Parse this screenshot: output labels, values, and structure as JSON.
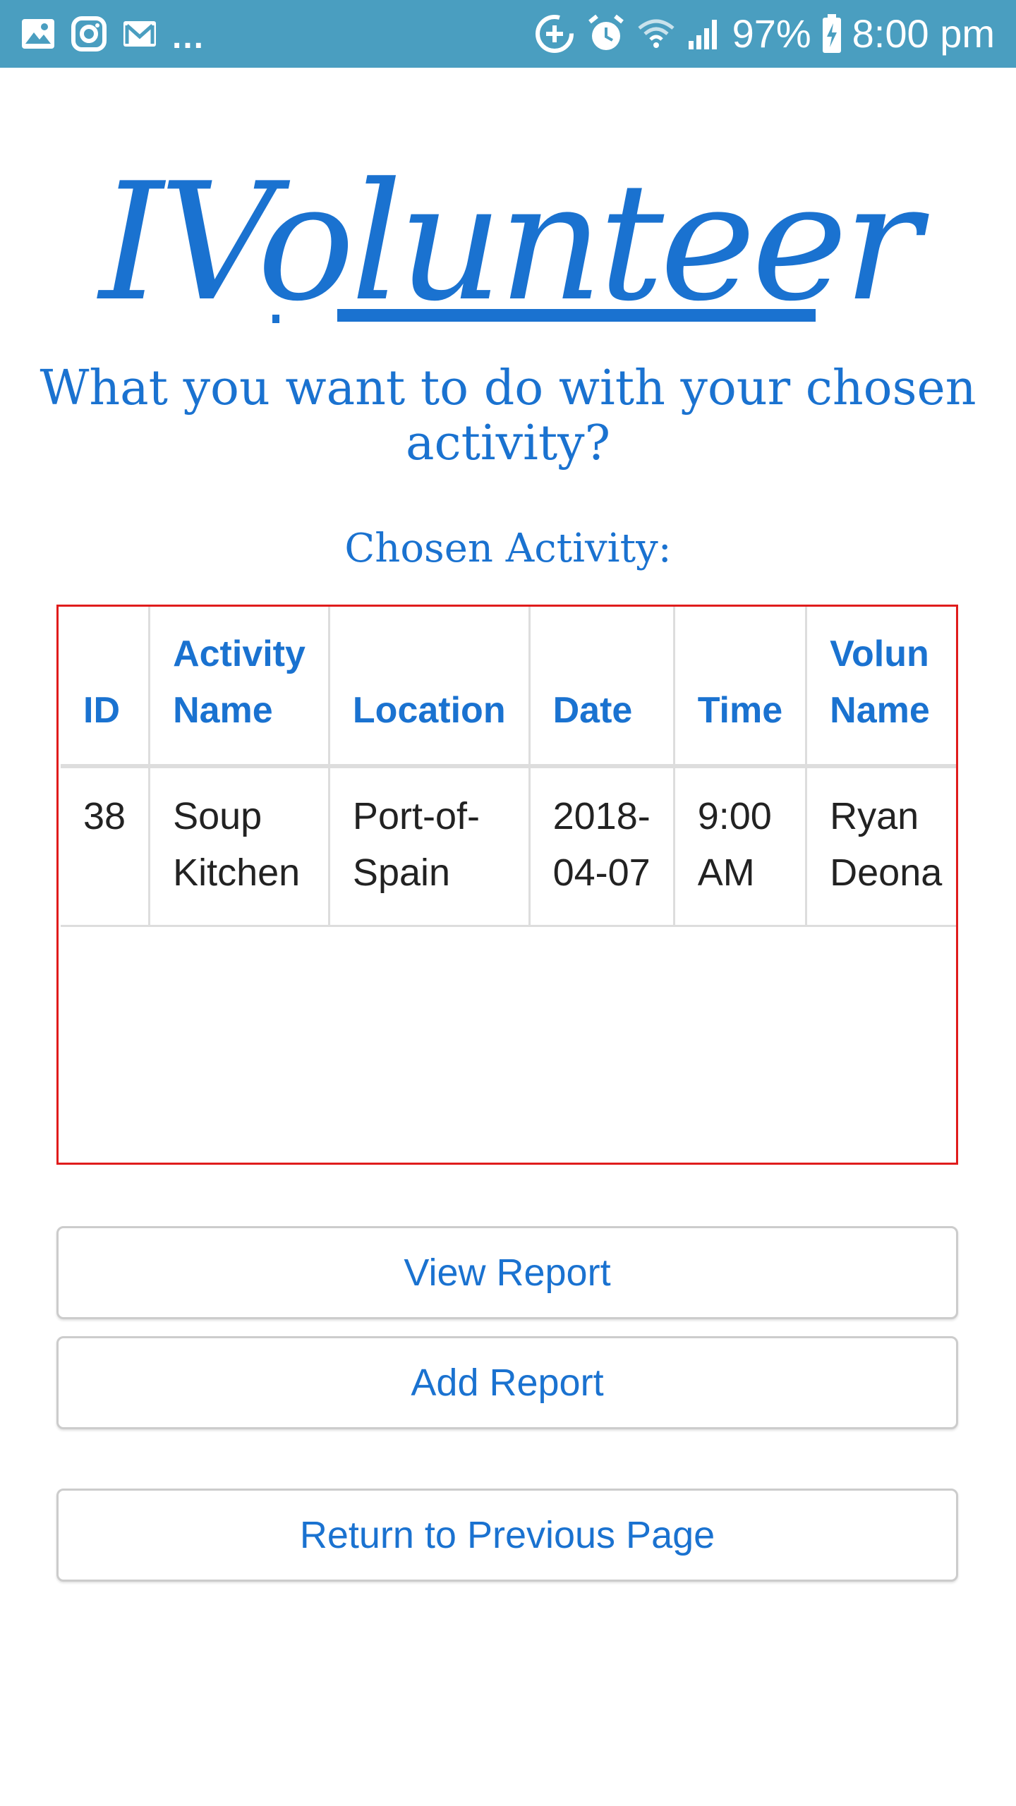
{
  "status_bar": {
    "left_icons": [
      "gallery-icon",
      "instagram-icon",
      "gmail-icon"
    ],
    "more": "...",
    "right_icons": [
      "data-saver-icon",
      "alarm-icon",
      "wifi-icon",
      "signal-icon",
      "battery-charging-icon"
    ],
    "battery": "97%",
    "time": "8:00 pm"
  },
  "app": {
    "logo": "IVolunteer",
    "heading": "What you want to do with your chosen activity?",
    "subheading": "Chosen Activity:"
  },
  "table": {
    "headers": [
      [
        "ID"
      ],
      [
        "Activity",
        "Name"
      ],
      [
        "Location"
      ],
      [
        "Date"
      ],
      [
        "Time"
      ],
      [
        "Volun",
        "Name"
      ]
    ],
    "rows": [
      [
        [
          "38"
        ],
        [
          "Soup",
          "Kitchen"
        ],
        [
          "Port-of-",
          "Spain"
        ],
        [
          "2018-",
          "04-07"
        ],
        [
          "9:00",
          "AM"
        ],
        [
          "Ryan",
          "Deona"
        ]
      ]
    ]
  },
  "buttons": {
    "view_report": "View Report",
    "add_report": "Add Report",
    "return": "Return to Previous Page"
  },
  "colors": {
    "status_bar": "#4a9ec0",
    "accent": "#1a72d0",
    "frame_border": "#e01c1c"
  }
}
